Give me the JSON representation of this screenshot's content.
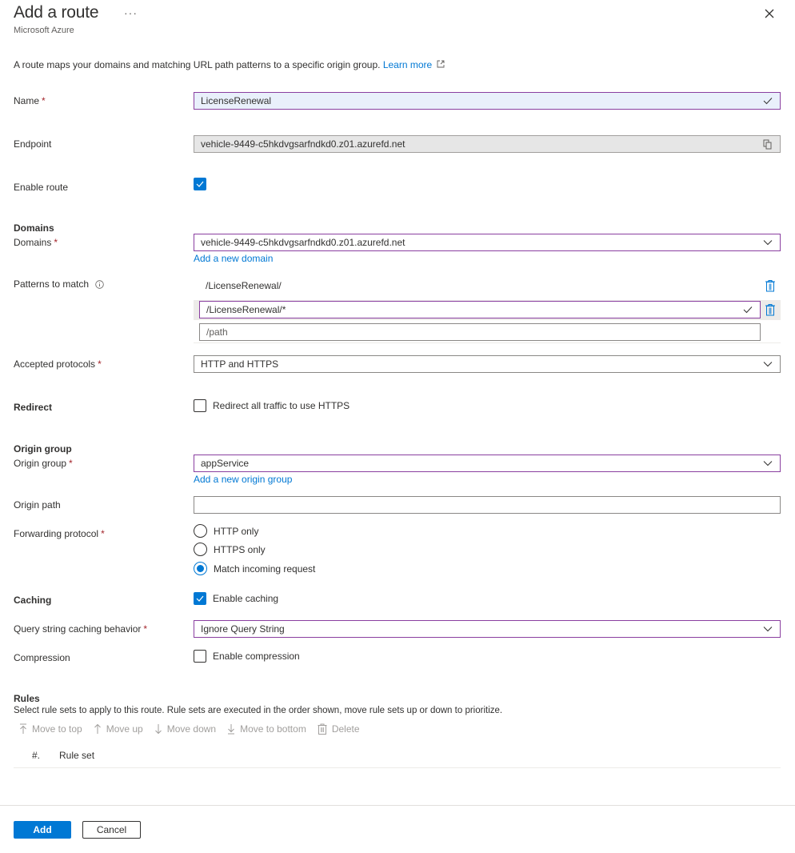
{
  "header": {
    "title": "Add a route",
    "more_icon": "ellipsis-icon",
    "subtitle": "Microsoft Azure",
    "close_icon": "close-icon"
  },
  "description": {
    "text": "A route maps your domains and matching URL path patterns to a specific origin group.",
    "learn_more": "Learn more",
    "learn_more_icon": "external-link-icon"
  },
  "form": {
    "name": {
      "label": "Name",
      "required": "*",
      "value": "LicenseRenewal",
      "valid_icon": "checkmark-icon"
    },
    "endpoint": {
      "label": "Endpoint",
      "value": "vehicle-9449-c5hkdvgsarfndkd0.z01.azurefd.net",
      "copy_icon": "copy-icon"
    },
    "enable_route": {
      "label": "Enable route",
      "checked": true
    },
    "domains_section": "Domains",
    "domains": {
      "label": "Domains",
      "required": "*",
      "value": "vehicle-9449-c5hkdvgsarfndkd0.z01.azurefd.net",
      "add_link": "Add a new domain"
    },
    "patterns": {
      "label": "Patterns to match",
      "info_icon": "info-icon",
      "items": [
        {
          "value": "/LicenseRenewal/"
        },
        {
          "value": "/LicenseRenewal/*"
        }
      ],
      "new_placeholder": "/path"
    },
    "accepted_protocols": {
      "label": "Accepted protocols",
      "required": "*",
      "value": "HTTP and HTTPS"
    },
    "redirect": {
      "label": "Redirect",
      "option": "Redirect all traffic to use HTTPS",
      "checked": false
    },
    "origin_section": "Origin group",
    "origin_group": {
      "label": "Origin group",
      "required": "*",
      "value": "appService",
      "add_link": "Add a new origin group"
    },
    "origin_path": {
      "label": "Origin path",
      "value": ""
    },
    "forwarding_protocol": {
      "label": "Forwarding protocol",
      "required": "*",
      "options": [
        "HTTP only",
        "HTTPS only",
        "Match incoming request"
      ],
      "selected": "Match incoming request"
    },
    "caching": {
      "label": "Caching",
      "option": "Enable caching",
      "checked": true
    },
    "query_string": {
      "label": "Query string caching behavior",
      "required": "*",
      "value": "Ignore Query String"
    },
    "compression": {
      "label": "Compression",
      "option": "Enable compression",
      "checked": false
    }
  },
  "rules": {
    "title": "Rules",
    "description": "Select rule sets to apply to this route. Rule sets are executed in the order shown, move rule sets up or down to prioritize.",
    "toolbar": [
      {
        "label": "Move to top",
        "icon": "arrow-to-top-icon"
      },
      {
        "label": "Move up",
        "icon": "arrow-up-icon"
      },
      {
        "label": "Move down",
        "icon": "arrow-down-icon"
      },
      {
        "label": "Move to bottom",
        "icon": "arrow-to-bottom-icon"
      },
      {
        "label": "Delete",
        "icon": "trash-icon"
      }
    ],
    "columns": [
      "#.",
      "Rule set"
    ]
  },
  "footer": {
    "add_label": "Add",
    "cancel_label": "Cancel"
  },
  "colors": {
    "accent": "#0078d4",
    "focus_border": "#8a3fa0",
    "required": "#a4262c"
  }
}
